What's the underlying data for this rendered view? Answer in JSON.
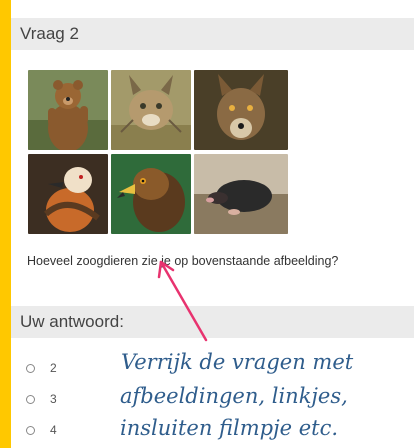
{
  "question": {
    "title": "Vraag 2",
    "text": "Hoeveel zoogdieren zie je op bovenstaande afbeelding?",
    "images": [
      {
        "name": "bear-image",
        "alt": "bear"
      },
      {
        "name": "lynx-image",
        "alt": "lynx"
      },
      {
        "name": "wolf-image",
        "alt": "wolf"
      },
      {
        "name": "vulture-image",
        "alt": "bearded vulture"
      },
      {
        "name": "eagle-image",
        "alt": "eagle"
      },
      {
        "name": "mole-image",
        "alt": "mole"
      }
    ]
  },
  "answer": {
    "title": "Uw antwoord:",
    "options": [
      "2",
      "3",
      "4"
    ]
  },
  "annotation": {
    "lines": [
      "Verrijk de vragen met",
      "afbeeldingen, linkjes,",
      "insluiten filmpje etc."
    ],
    "color": "#2f5d8c",
    "arrow_color": "#e8336f"
  },
  "colors": {
    "background": "#ffc800",
    "header_bar": "#ebebeb"
  }
}
